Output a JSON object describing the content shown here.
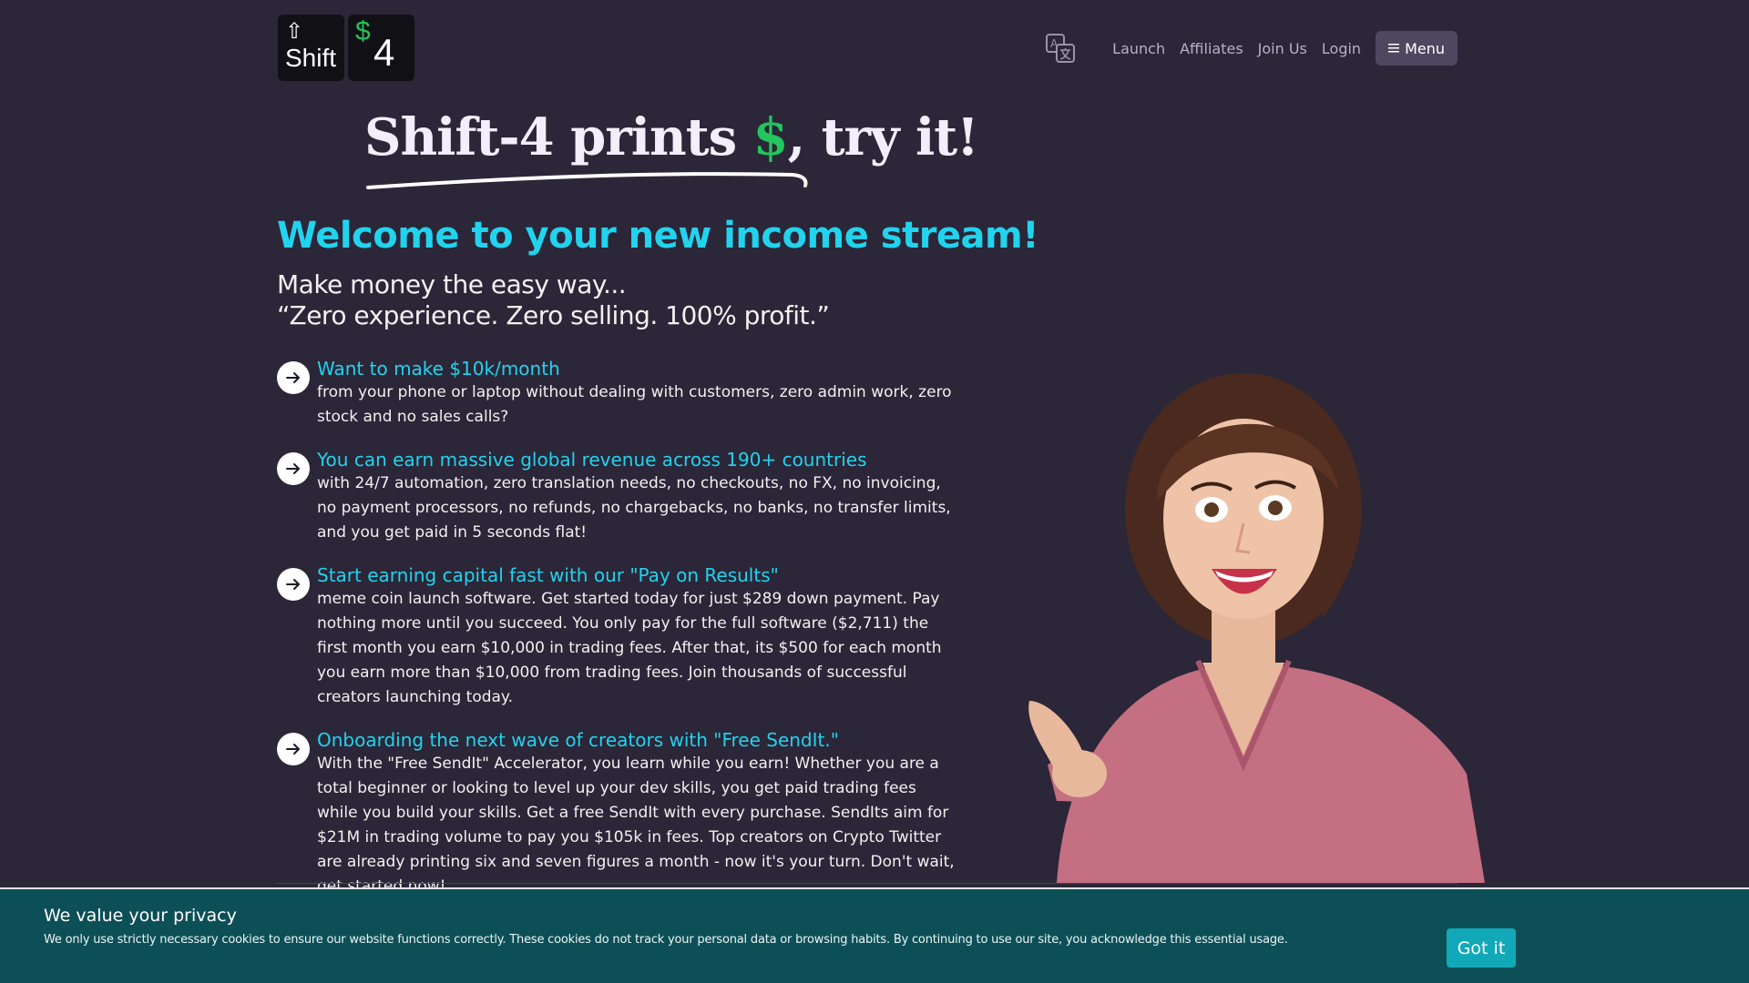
{
  "logo": {
    "shift_label": "Shift",
    "dollar": "$",
    "number": "4"
  },
  "nav": {
    "links": [
      "Launch",
      "Affiliates",
      "Join Us",
      "Login"
    ],
    "menu_label": "Menu"
  },
  "hero": {
    "title_start": "Shift-4 prints ",
    "title_money": "$",
    "title_end": ", try it!"
  },
  "welcome": "Welcome to your new income stream!",
  "sublines": [
    "Make money the easy way...",
    "“Zero experience. Zero selling. 100%  profit.”"
  ],
  "features": [
    {
      "title": "Want to make $10k/month",
      "body": "from your phone or laptop without dealing with customers, zero admin work, zero stock and no sales calls?"
    },
    {
      "title": "You can earn massive global revenue across 190+ countries",
      "body": "with 24/7 automation, zero translation needs, no checkouts, no FX, no invoicing, no payment processors, no refunds, no chargebacks, no banks, no transfer limits, and you get paid in 5 seconds flat!"
    },
    {
      "title": "Start earning capital fast with our \"Pay on Results\"",
      "body": "meme coin launch software. Get started today for just $289 down payment. Pay nothing more until you succeed. You only pay for the full software ($2,711) the first month you earn $10,000 in trading fees. After that, its $500 for each month you earn more than $10,000 from trading fees. Join thousands of successful creators launching today."
    },
    {
      "title": "Onboarding the next wave of creators with \"Free SendIt.\"",
      "body": "With the \"Free SendIt\" Accelerator, you learn while you earn! Whether you are a total beginner or looking to level up your dev skills, you get paid trading fees while you build your skills. Get a free SendIt with every purchase. SendIts aim for $21M in trading volume to pay you $105k in fees. Top creators on Crypto Twitter are already printing six and seven figures a month - now it's your turn. Don't wait, get started now!"
    }
  ],
  "cookie": {
    "title": "We value your privacy",
    "text": "We only use strictly necessary cookies to ensure our website functions correctly. These cookies do not track your personal data or browsing habits. By continuing to use our site, you acknowledge this essential usage.",
    "button": "Got it"
  },
  "colors": {
    "background": "#2b2638",
    "accent_cyan": "#22d3ee",
    "money_green": "#22c55e",
    "cookie_bg": "#0d4f56",
    "cookie_button": "#11a9b8"
  },
  "icons": {
    "translate": "translate-icon",
    "shift_arrow": "shift-arrow-icon",
    "menu": "hamburger-icon",
    "feature_arrow": "arrow-right-icon"
  }
}
